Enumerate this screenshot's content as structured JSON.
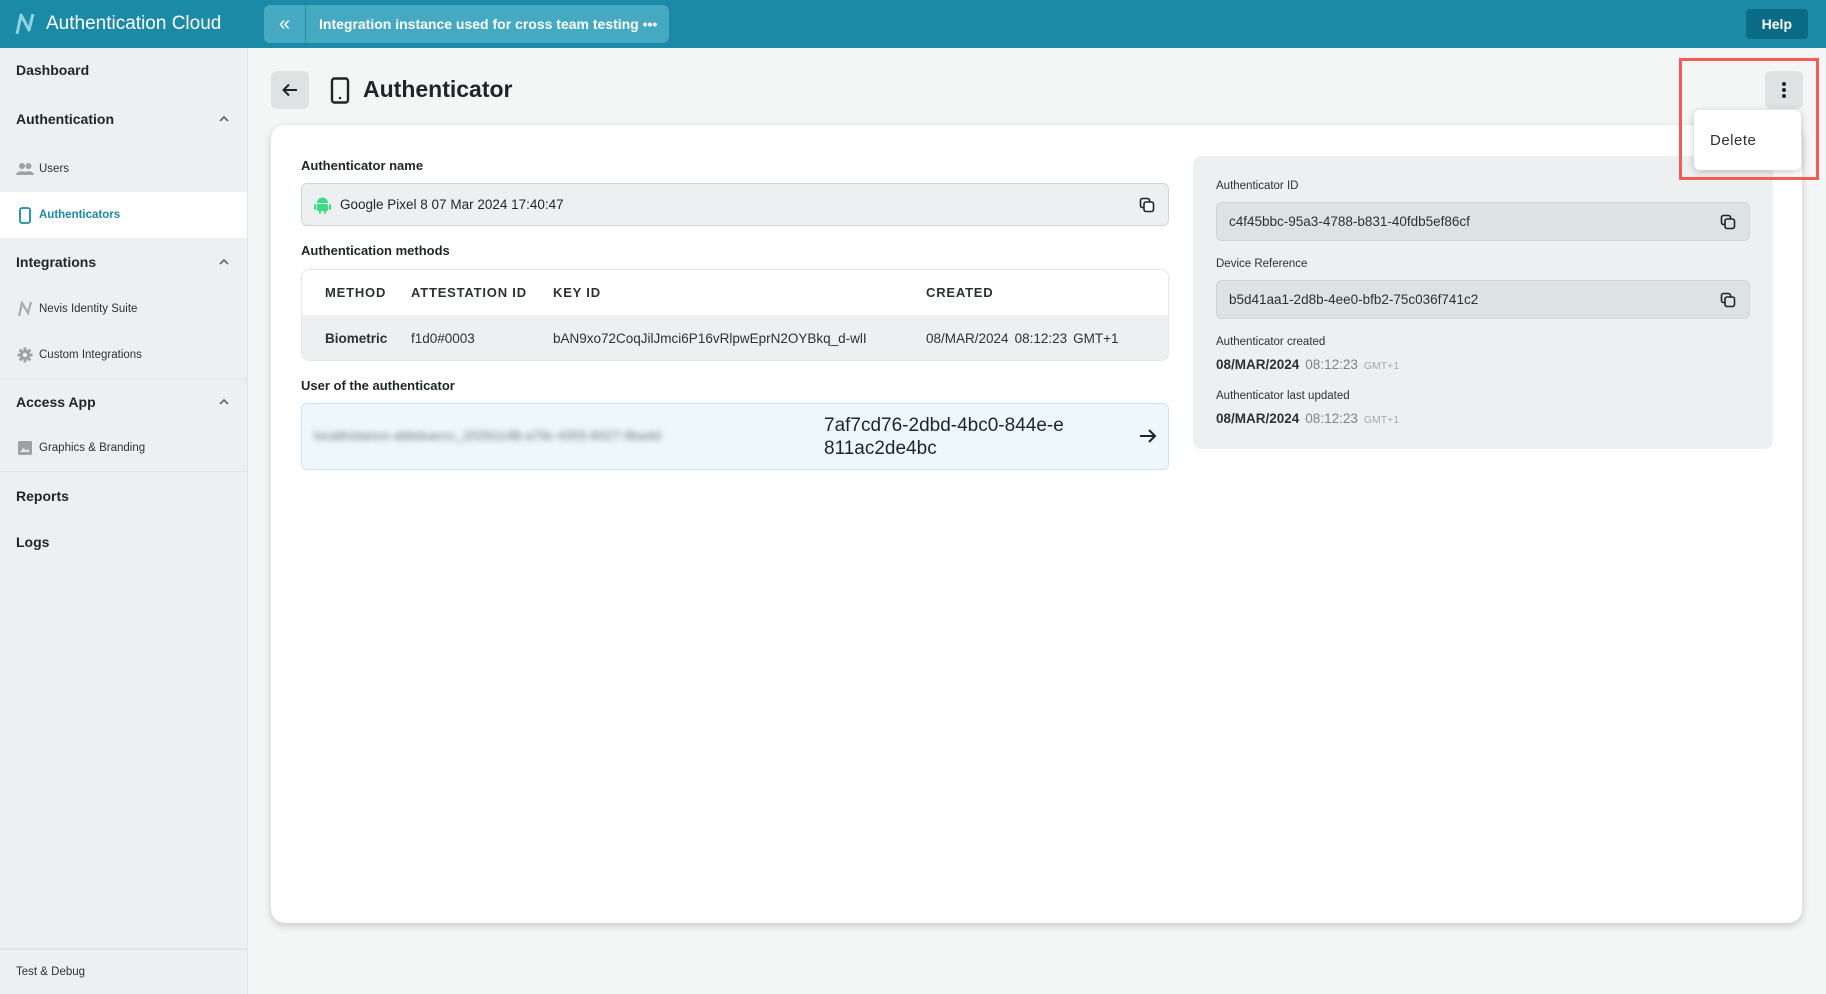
{
  "header": {
    "app_title": "Authentication Cloud",
    "instance_name": "Integration instance used for cross team testing •••",
    "help_label": "Help",
    "colors": {
      "primary": "#1a8aa6",
      "instance_bg": "#45a9c2",
      "help_bg": "#0a6b86"
    }
  },
  "sidebar": {
    "dashboard": "Dashboard",
    "sections": [
      {
        "label": "Authentication",
        "items": [
          {
            "label": "Users",
            "icon": "users-icon"
          },
          {
            "label": "Authenticators",
            "icon": "phone-icon",
            "active": true
          }
        ]
      },
      {
        "label": "Integrations",
        "items": [
          {
            "label": "Nevis Identity Suite",
            "icon": "nevis-logo-icon"
          },
          {
            "label": "Custom Integrations",
            "icon": "gear-icon"
          }
        ]
      },
      {
        "label": "Access App",
        "items": [
          {
            "label": "Graphics & Branding",
            "icon": "image-icon"
          }
        ]
      }
    ],
    "reports": "Reports",
    "logs": "Logs",
    "bottom": "Test & Debug"
  },
  "page": {
    "title": "Authenticator",
    "more_menu": {
      "items": [
        "Delete"
      ]
    }
  },
  "details": {
    "name_label": "Authenticator name",
    "name_value": "Google Pixel 8 07 Mar 2024 17:40:47",
    "methods_label": "Authentication methods",
    "methods_columns": [
      "METHOD",
      "ATTESTATION ID",
      "KEY ID",
      "CREATED"
    ],
    "methods_rows": [
      {
        "method": "Biometric",
        "attestation_id": "f1d0#0003",
        "key_id": "bAN9xo72CoqJilJmci6P16vRlpwEprN2OYBkq_d-wlI",
        "created_date": "08/MAR/2024",
        "created_time": "08:12:23",
        "created_tz": "GMT+1"
      }
    ],
    "user_label": "User of the authenticator",
    "user_blurred": "localinstance-abbdxaccc_2029114B-a79c-4355-8427-9ba4d",
    "user_id": "7af7cd76-2dbd-4bc0-844e-e811ac2de4bc"
  },
  "side": {
    "auth_id_label": "Authenticator ID",
    "auth_id": "c4f45bbc-95a3-4788-b831-40fdb5ef86cf",
    "device_ref_label": "Device Reference",
    "device_ref": "b5d41aa1-2d8b-4ee0-bfb2-75c036f741c2",
    "created_label": "Authenticator created",
    "created_date": "08/MAR/2024",
    "created_time": "08:12:23",
    "created_tz": "GMT+1",
    "updated_label": "Authenticator last updated",
    "updated_date": "08/MAR/2024",
    "updated_time": "08:12:23",
    "updated_tz": "GMT+1"
  }
}
